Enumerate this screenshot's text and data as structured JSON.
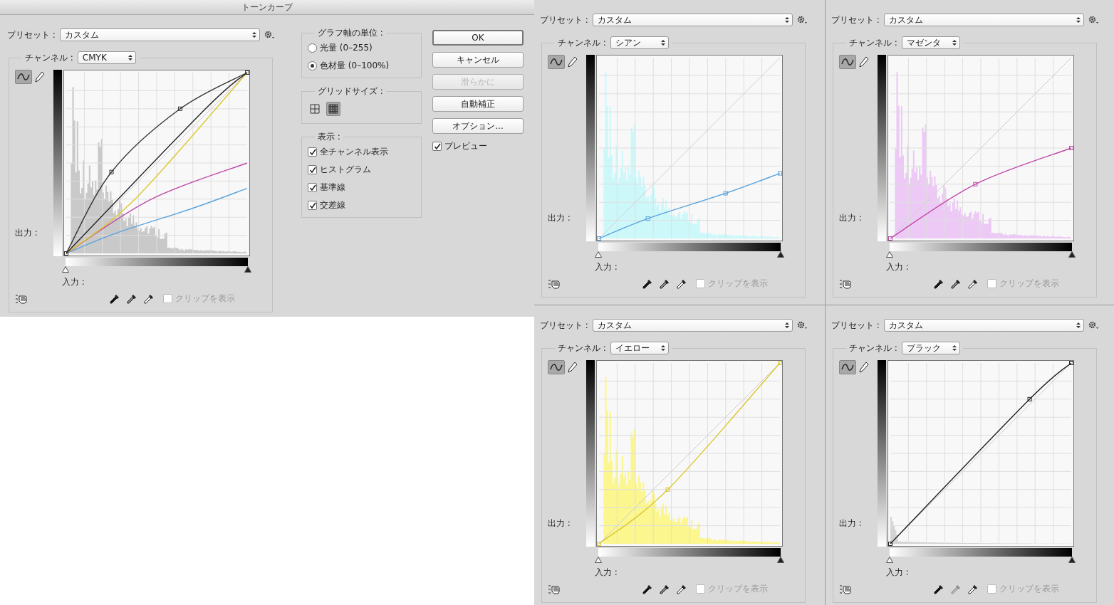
{
  "dialog": {
    "title": "トーンカーブ",
    "preset_label": "プリセット :",
    "preset": "カスタム",
    "channel_label": "チャンネル :",
    "channel": "CMYK",
    "output_label": "出力 :",
    "input_label": "入力 :",
    "clip_label": "クリップを表示",
    "clip_checked": false,
    "eyedroppers": [
      {
        "kind": "black",
        "disabled": false
      },
      {
        "kind": "gray",
        "disabled": false
      },
      {
        "kind": "white",
        "disabled": false
      }
    ],
    "axis_units": {
      "title": "グラフ軸の単位 :",
      "options": [
        {
          "label": "光量 (0–255)",
          "selected": false
        },
        {
          "label": "色材量 (0–100%)",
          "selected": true
        }
      ]
    },
    "grid_size": {
      "title": "グリッドサイズ :",
      "options": [
        {
          "kind": "coarse",
          "selected": false
        },
        {
          "kind": "fine",
          "selected": true
        }
      ]
    },
    "display": {
      "title": "表示 :",
      "items": [
        {
          "label": "全チャンネル表示",
          "checked": true
        },
        {
          "label": "ヒストグラム",
          "checked": true
        },
        {
          "label": "基準線",
          "checked": true
        },
        {
          "label": "交差線",
          "checked": true
        }
      ]
    },
    "buttons": [
      {
        "label": "OK",
        "kind": "default",
        "disabled": false
      },
      {
        "label": "キャンセル",
        "kind": "normal",
        "disabled": false
      },
      {
        "label": "滑らかに",
        "kind": "normal",
        "disabled": true
      },
      {
        "label": "自動補正",
        "kind": "normal",
        "disabled": false
      },
      {
        "label": "オプション...",
        "kind": "normal",
        "disabled": false
      }
    ],
    "preview": {
      "label": "プレビュー",
      "checked": true
    }
  },
  "panels": [
    {
      "preset_label": "プリセット :",
      "preset": "カスタム",
      "channel_label": "チャンネル :",
      "channel": "シアン",
      "color": "#5ba3dc",
      "output_label": "出力 :",
      "input_label": "入力 :",
      "clip_label": "クリップを表示",
      "clip_checked": false,
      "eyedroppers": [
        {
          "kind": "black",
          "disabled": false
        },
        {
          "kind": "gray",
          "disabled": false
        },
        {
          "kind": "white",
          "disabled": false
        }
      ]
    },
    {
      "preset_label": "プリセット :",
      "preset": "カスタム",
      "channel_label": "チャンネル :",
      "channel": "マゼンタ",
      "color": "#c04aa8",
      "output_label": "出力 :",
      "input_label": "入力 :",
      "clip_label": "クリップを表示",
      "clip_checked": false,
      "eyedroppers": [
        {
          "kind": "black",
          "disabled": false
        },
        {
          "kind": "gray",
          "disabled": false
        },
        {
          "kind": "white",
          "disabled": false
        }
      ]
    },
    {
      "preset_label": "プリセット :",
      "preset": "カスタム",
      "channel_label": "チャンネル :",
      "channel": "イエロー",
      "color": "#dcc830",
      "output_label": "出力 :",
      "input_label": "入力 :",
      "clip_label": "クリップを表示",
      "clip_checked": false,
      "eyedroppers": [
        {
          "kind": "black",
          "disabled": false
        },
        {
          "kind": "gray",
          "disabled": false
        },
        {
          "kind": "white",
          "disabled": false
        }
      ]
    },
    {
      "preset_label": "プリセット :",
      "preset": "カスタム",
      "channel_label": "チャンネル :",
      "channel": "ブラック",
      "color": "#222222",
      "output_label": "出力 :",
      "input_label": "入力 :",
      "clip_label": "クリップを表示",
      "clip_checked": false,
      "eyedroppers": [
        {
          "kind": "black",
          "disabled": false
        },
        {
          "kind": "gray",
          "disabled": true
        },
        {
          "kind": "white",
          "disabled": false
        }
      ]
    }
  ]
}
